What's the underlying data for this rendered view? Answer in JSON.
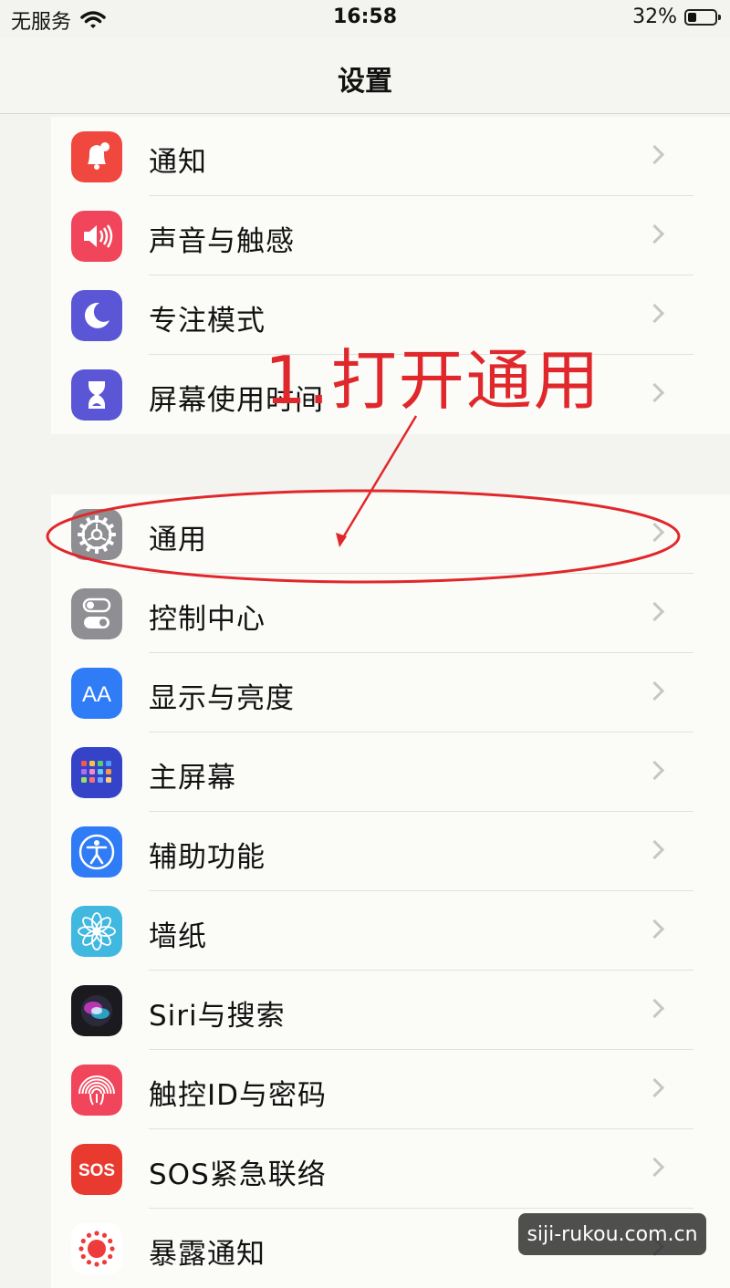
{
  "status_bar": {
    "carrier": "无服务",
    "time": "16:58",
    "battery_percent": "32%",
    "battery_level": 0.32
  },
  "nav": {
    "title": "设置"
  },
  "group1": [
    {
      "label": "通知",
      "icon": "bell-icon",
      "color": "#f0473e"
    },
    {
      "label": "声音与触感",
      "icon": "speaker-icon",
      "color": "#f0455a"
    },
    {
      "label": "专注模式",
      "icon": "moon-icon",
      "color": "#5b56d6"
    },
    {
      "label": "屏幕使用时间",
      "icon": "hourglass-icon",
      "color": "#5b56d6"
    }
  ],
  "group2": [
    {
      "label": "通用",
      "icon": "gear-icon",
      "color": "#8e8e93"
    },
    {
      "label": "控制中心",
      "icon": "toggles-icon",
      "color": "#8e8e93"
    },
    {
      "label": "显示与亮度",
      "icon": "text-size-icon",
      "color": "#2f7cf6"
    },
    {
      "label": "主屏幕",
      "icon": "home-grid-icon",
      "color": "#3543c9"
    },
    {
      "label": "辅助功能",
      "icon": "accessibility-icon",
      "color": "#2f7cf6"
    },
    {
      "label": "墙纸",
      "icon": "flower-icon",
      "color": "#41b8e0"
    },
    {
      "label": "Siri与搜索",
      "icon": "siri-icon",
      "color": "#222222"
    },
    {
      "label": "触控ID与密码",
      "icon": "fingerprint-icon",
      "color": "#f0455a"
    },
    {
      "label": "SOS紧急联络",
      "icon": "sos-icon",
      "color": "#e93a2f",
      "icon_text": "SOS"
    },
    {
      "label": "暴露通知",
      "icon": "exposure-icon",
      "color": "#ffffff"
    }
  ],
  "annotation": {
    "text": "1.打开通用",
    "color": "#e0282c"
  },
  "watermark": {
    "text": "siji-rukou.com.cn"
  }
}
